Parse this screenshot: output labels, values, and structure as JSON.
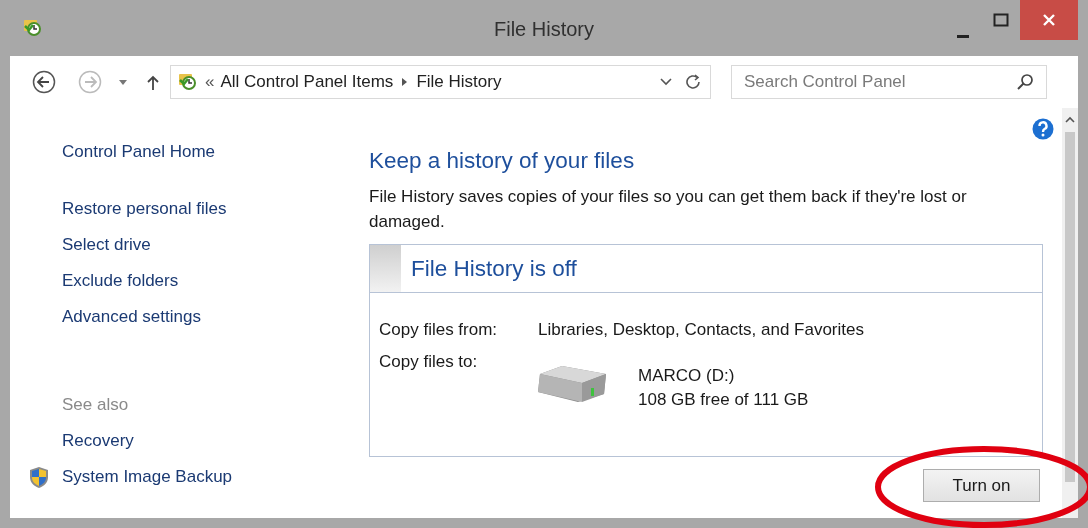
{
  "window": {
    "title": "File History"
  },
  "navigation": {
    "back": {
      "disabled": false
    },
    "forward": {
      "disabled": true
    },
    "overflow": "«",
    "breadcrumb": [
      "All Control Panel Items",
      "File History"
    ],
    "search": {
      "placeholder": "Search Control Panel"
    }
  },
  "sidebar": {
    "items": [
      {
        "label": "Control Panel Home"
      },
      {
        "label": "Restore personal files"
      },
      {
        "label": "Select drive"
      },
      {
        "label": "Exclude folders"
      },
      {
        "label": "Advanced settings"
      }
    ],
    "see_also": {
      "heading": "See also",
      "items": [
        {
          "label": "Recovery",
          "shield": false
        },
        {
          "label": "System Image Backup",
          "shield": true
        }
      ]
    }
  },
  "main": {
    "heading": "Keep a history of your files",
    "description": "File History saves copies of your files so you can get them back if they're lost or damaged.",
    "status": {
      "title": "File History is off",
      "from_label": "Copy files from:",
      "from_value": "Libraries, Desktop, Contacts, and Favorites",
      "to_label": "Copy files to:",
      "drive_name": "MARCO (D:)",
      "drive_space": "108 GB free of 111 GB"
    },
    "button": "Turn on"
  },
  "annotation": {
    "kind": "ellipse"
  }
}
